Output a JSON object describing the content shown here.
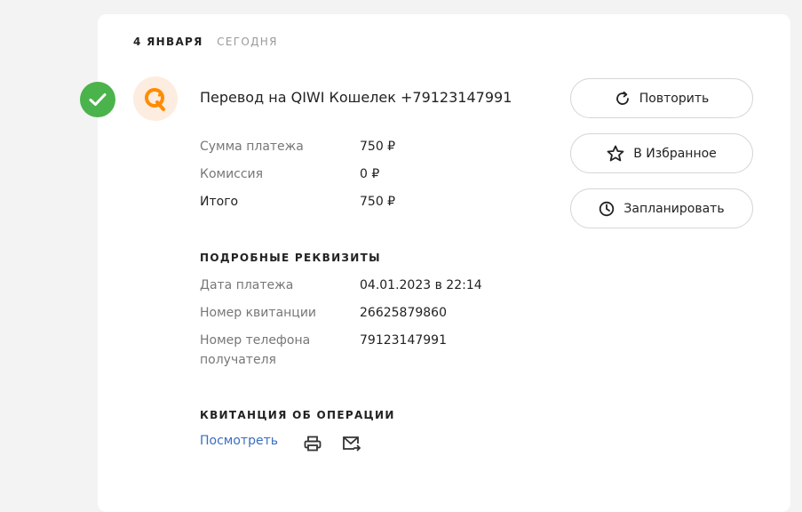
{
  "header": {
    "date": "4 ЯНВАРЯ",
    "today": "СЕГОДНЯ"
  },
  "operation": {
    "title": "Перевод на QIWI Кошелек +79123147991",
    "status_icon": "check-icon",
    "logo_icon": "qiwi-logo-icon"
  },
  "summary": [
    {
      "label": "Сумма платежа",
      "value": "750 ₽"
    },
    {
      "label": "Комиссия",
      "value": "0 ₽"
    },
    {
      "label": "Итого",
      "value": "750 ₽"
    }
  ],
  "details": {
    "heading": "ПОДРОБНЫЕ РЕКВИЗИТЫ",
    "rows": [
      {
        "label": "Дата платежа",
        "value": "04.01.2023 в 22:14"
      },
      {
        "label": "Номер квитанции",
        "value": "26625879860"
      },
      {
        "label": "Номер телефона получателя",
        "value": "79123147991"
      }
    ]
  },
  "receipt": {
    "heading": "КВИТАНЦИЯ ОБ ОПЕРАЦИИ",
    "view_label": "Посмотреть"
  },
  "actions": {
    "repeat": "Повторить",
    "favorite": "В Избранное",
    "schedule": "Запланировать"
  },
  "colors": {
    "success": "#4bb34b",
    "brand": "#ff8c00",
    "link": "#3a6ec0"
  }
}
